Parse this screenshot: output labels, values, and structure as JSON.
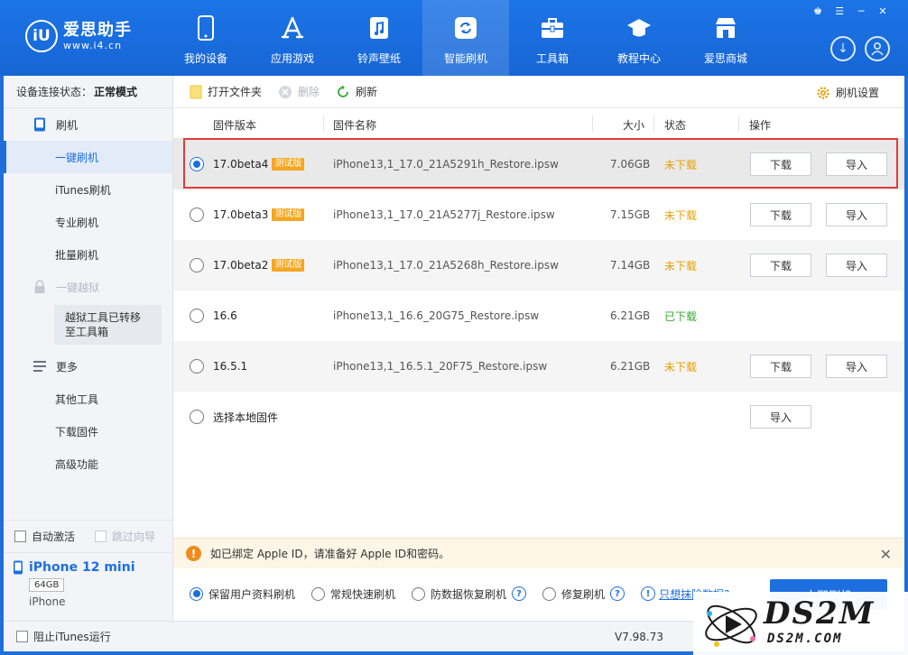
{
  "app": {
    "logo_badge": "iU",
    "logo_name": "爱思助手",
    "logo_url": "www.i4.cn"
  },
  "nav": [
    {
      "label": "我的设备",
      "icon": "phone-icon"
    },
    {
      "label": "应用游戏",
      "icon": "app-store-icon"
    },
    {
      "label": "铃声壁纸",
      "icon": "music-file-icon"
    },
    {
      "label": "智能刷机",
      "icon": "refresh-box-icon",
      "active": true
    },
    {
      "label": "工具箱",
      "icon": "toolbox-icon"
    },
    {
      "label": "教程中心",
      "icon": "graduation-cap-icon"
    },
    {
      "label": "爱思商城",
      "icon": "store-icon"
    }
  ],
  "sidebar": {
    "conn_label": "设备连接状态：",
    "conn_value": "正常模式",
    "flash_group": "刷机",
    "flash_items": [
      "一键刷机",
      "iTunes刷机",
      "专业刷机",
      "批量刷机"
    ],
    "jailbreak_group": "一键越狱",
    "jailbreak_note": "越狱工具已转移至工具箱",
    "more_group": "更多",
    "more_items": [
      "其他工具",
      "下载固件",
      "高级功能"
    ],
    "auto_activate": "自动激活",
    "skip_guide": "跳过向导"
  },
  "device": {
    "name": "iPhone 12 mini",
    "capacity": "64GB",
    "type": "iPhone"
  },
  "toolbar": {
    "open_folder": "打开文件夹",
    "delete": "删除",
    "refresh": "刷新",
    "settings": "刷机设置"
  },
  "table": {
    "headers": {
      "version": "固件版本",
      "name": "固件名称",
      "size": "大小",
      "status": "状态",
      "action": "操作"
    },
    "rows": [
      {
        "version": "17.0beta4",
        "beta": "测试版",
        "file": "iPhone13,1_17.0_21A5291h_Restore.ipsw",
        "size": "7.06GB",
        "status": "未下载",
        "download": "下载",
        "import": "导入",
        "selected": true
      },
      {
        "version": "17.0beta3",
        "beta": "测试版",
        "file": "iPhone13,1_17.0_21A5277j_Restore.ipsw",
        "size": "7.15GB",
        "status": "未下载",
        "download": "下载",
        "import": "导入"
      },
      {
        "version": "17.0beta2",
        "beta": "测试版",
        "file": "iPhone13,1_17.0_21A5268h_Restore.ipsw",
        "size": "7.14GB",
        "status": "未下载",
        "download": "下载",
        "import": "导入"
      },
      {
        "version": "16.6",
        "beta": "",
        "file": "iPhone13,1_16.6_20G75_Restore.ipsw",
        "size": "6.21GB",
        "status": "已下载",
        "download": "",
        "import": ""
      },
      {
        "version": "16.5.1",
        "beta": "",
        "file": "iPhone13,1_16.5.1_20F75_Restore.ipsw",
        "size": "6.21GB",
        "status": "未下载",
        "download": "下载",
        "import": "导入"
      },
      {
        "version": "选择本地固件",
        "beta": "",
        "file": "",
        "size": "",
        "status": "",
        "download": "",
        "import": "导入"
      }
    ]
  },
  "notice": {
    "text": "如已绑定 Apple ID，请准备好 Apple ID和密码。"
  },
  "options": {
    "keep_data": "保留用户资料刷机",
    "quick": "常规快速刷机",
    "anti_recovery": "防数据恢复刷机",
    "repair": "修复刷机",
    "link": "只想抹除数据?",
    "flash_button": "立即刷机"
  },
  "statusbar": {
    "block_itunes": "阻止iTunes运行",
    "version": "V7.98.73"
  },
  "watermark": {
    "text": "DS2M",
    "sub": "DS2M.COM"
  },
  "colors": {
    "brand": "#1d6fe0",
    "pending": "#e8a000",
    "done": "#3aa835",
    "highlight": "#e03b3b"
  }
}
